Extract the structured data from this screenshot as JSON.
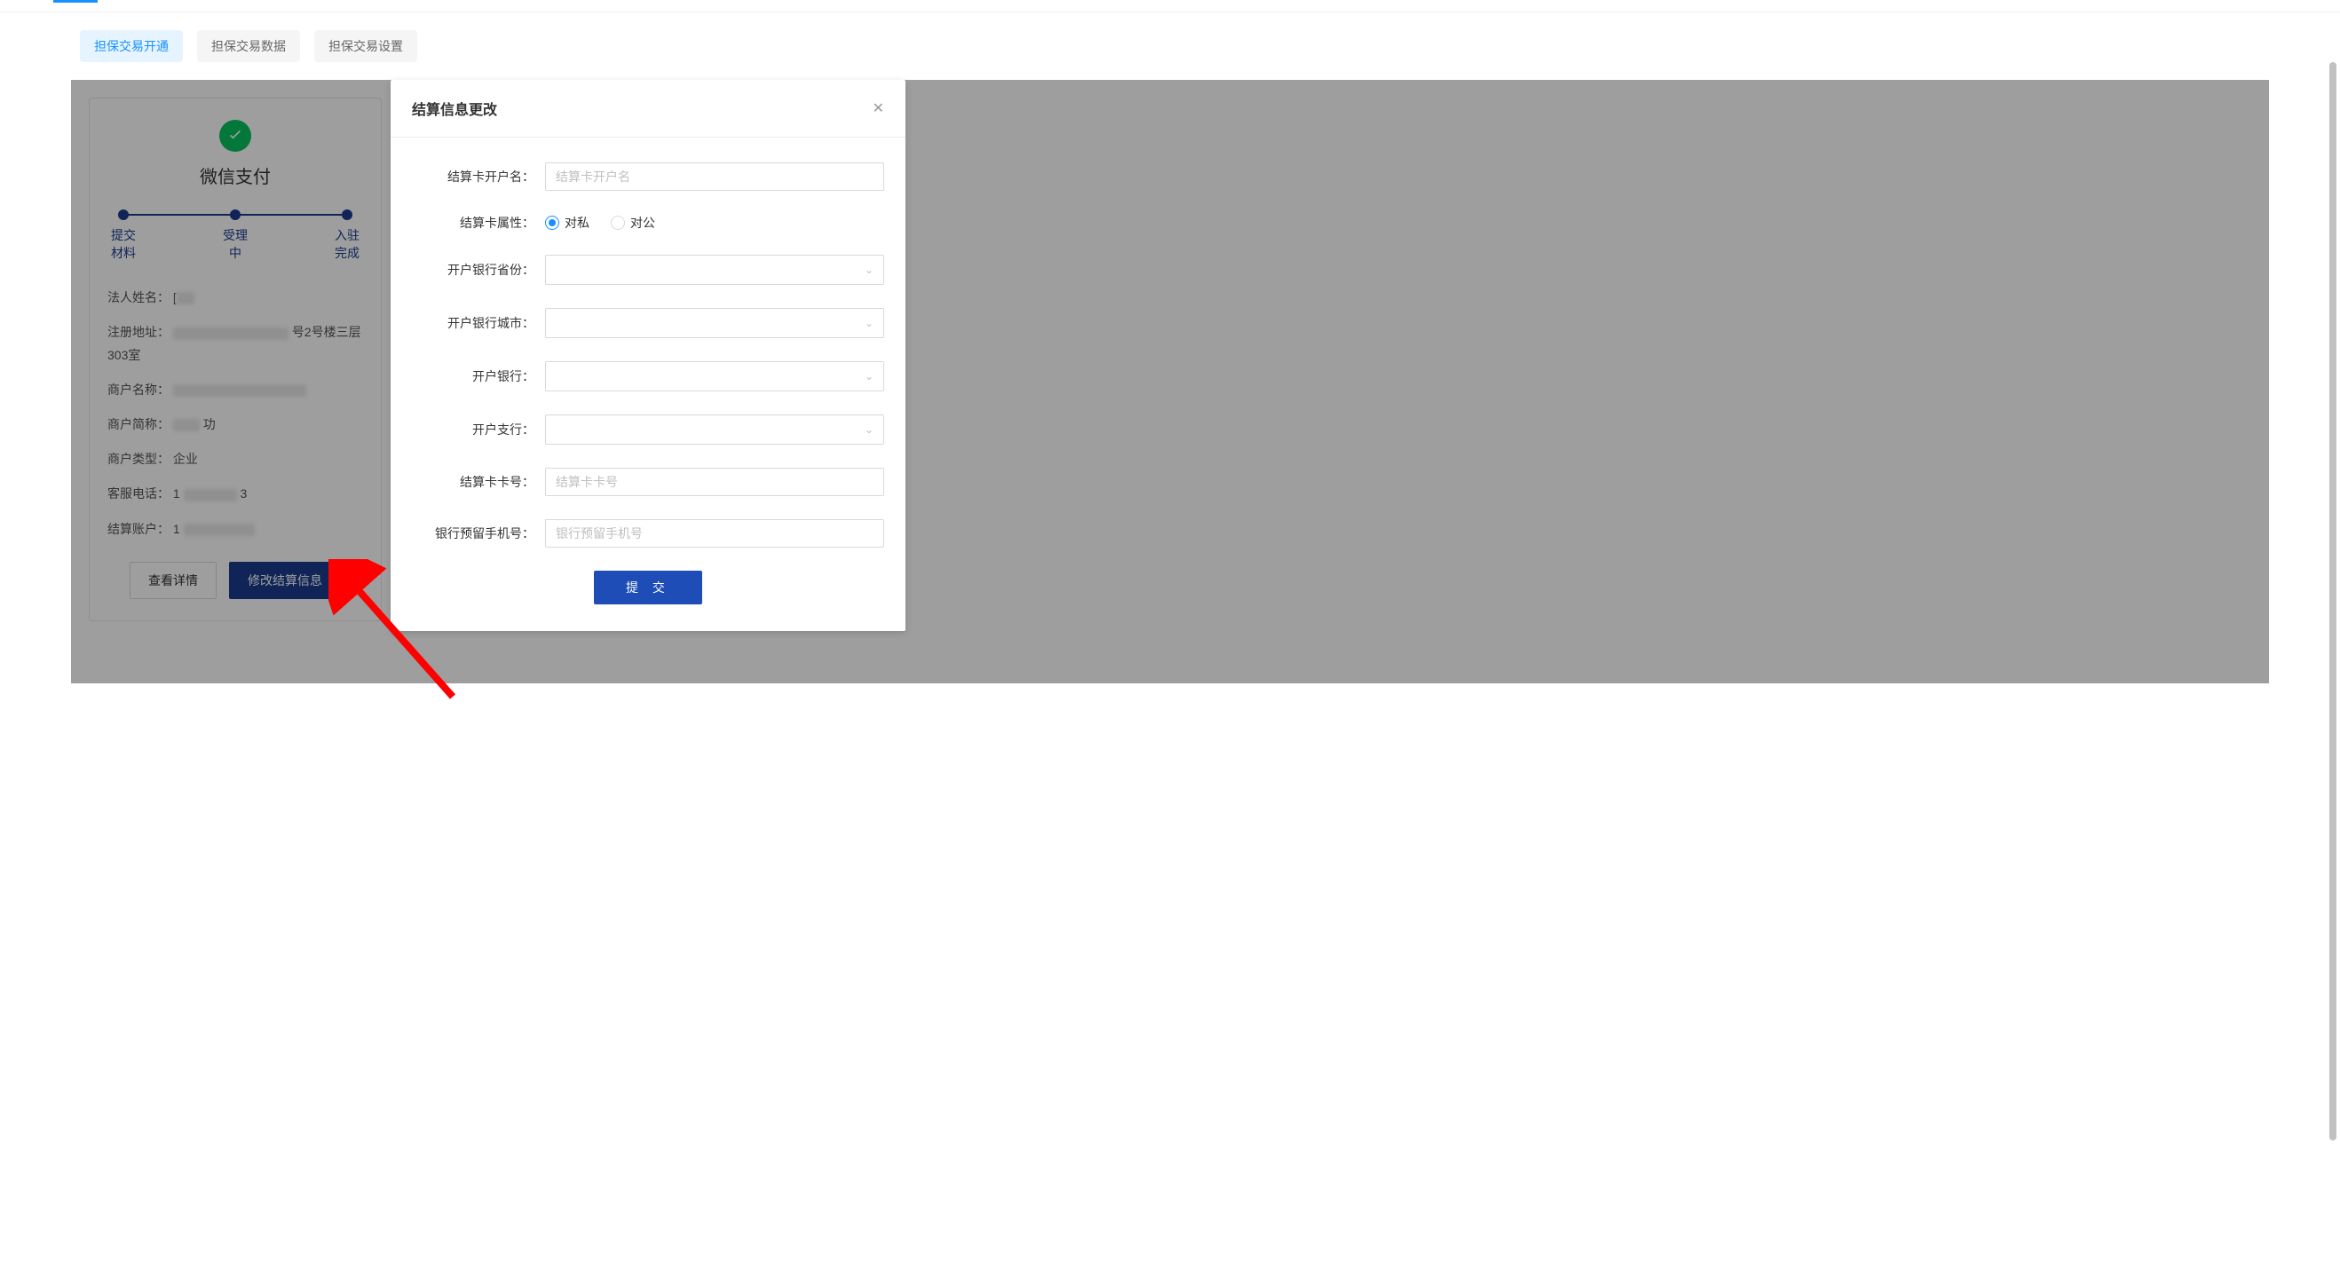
{
  "tabs": [
    {
      "label": "担保交易开通",
      "active": true
    },
    {
      "label": "担保交易数据",
      "active": false
    },
    {
      "label": "担保交易设置",
      "active": false
    }
  ],
  "card": {
    "payment_title": "微信支付",
    "steps": [
      {
        "label": "提交\n材料"
      },
      {
        "label": "受理\n中"
      },
      {
        "label": "入驻\n完成"
      }
    ],
    "labels": {
      "legal_name": "法人姓名：",
      "reg_address": "注册地址：",
      "merchant_name": "商户名称：",
      "merchant_short": "商户简称：",
      "merchant_type": "商户类型：",
      "service_phone": "客服电话：",
      "settle_account": "结算账户："
    },
    "values": {
      "legal_name_partial": "[",
      "reg_address_partial_prefix": "",
      "reg_address_partial_suffix": "号2号楼三层303室",
      "merchant_name_partial": "",
      "merchant_short_partial": "功",
      "merchant_type": "企业",
      "service_phone_partial_prefix": "1",
      "service_phone_partial_suffix": "3",
      "settle_account_partial": "1"
    },
    "buttons": {
      "view_detail": "查看详情",
      "modify_settlement": "修改结算信息"
    }
  },
  "modal": {
    "title": "结算信息更改",
    "fields": {
      "account_name": {
        "label": "结算卡开户名：",
        "placeholder": "结算卡开户名"
      },
      "card_type": {
        "label": "结算卡属性：",
        "option_private": "对私",
        "option_public": "对公"
      },
      "bank_province": {
        "label": "开户银行省份："
      },
      "bank_city": {
        "label": "开户银行城市："
      },
      "bank_name": {
        "label": "开户银行："
      },
      "bank_branch": {
        "label": "开户支行："
      },
      "card_number": {
        "label": "结算卡卡号：",
        "placeholder": "结算卡卡号"
      },
      "reserved_phone": {
        "label": "银行预留手机号：",
        "placeholder": "银行预留手机号"
      }
    },
    "submit": "提 交"
  }
}
